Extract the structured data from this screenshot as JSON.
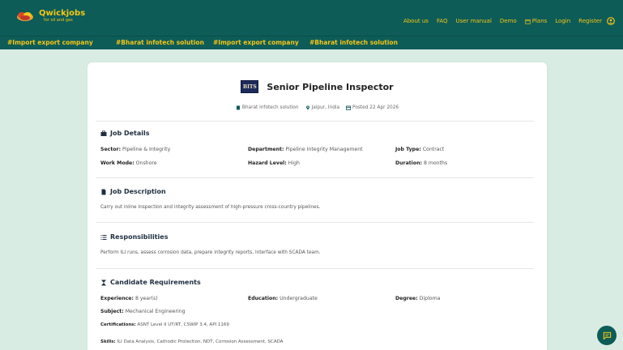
{
  "brand": {
    "name": "Qwickjobs",
    "tagline": "for oil and gas"
  },
  "nav": {
    "links": [
      "About us",
      "FAQ",
      "User manual",
      "Demo",
      "Plans",
      "Login",
      "Register"
    ]
  },
  "ticker": {
    "items": [
      "#Import export company",
      "#Bharat infotech solution",
      "#Import export company",
      "#Bharat infotech solution"
    ]
  },
  "job": {
    "logo_text": "BITS",
    "title": "Senior Pipeline Inspector",
    "company": "Bharat infotech solution",
    "location": "Jaipur, India",
    "posted": "Posted 22 Apr 2026"
  },
  "details": {
    "title": "Job Details",
    "sector_label": "Sector:",
    "sector": "Pipeline & Integrity",
    "department_label": "Department:",
    "department": "Pipeline Integrity Management",
    "job_type_label": "Job Type:",
    "job_type": "Contract",
    "work_mode_label": "Work Mode:",
    "work_mode": "Onshore",
    "hazard_label": "Hazard Level:",
    "hazard": "High",
    "duration_label": "Duration:",
    "duration": "8 months"
  },
  "description": {
    "title": "Job Description",
    "text": "Carry out inline inspection and integrity assessment of high-pressure cross-country pipelines."
  },
  "responsibilities": {
    "title": "Responsibilities",
    "text": "Perform ILI runs, assess corrosion data, prepare integrity reports, interface with SCADA team."
  },
  "requirements": {
    "title": "Candidate Requirements",
    "experience_label": "Experience:",
    "experience": "8 year(s)",
    "education_label": "Education:",
    "education": "Undergraduate",
    "degree_label": "Degree:",
    "degree": "Diploma",
    "subject_label": "Subject:",
    "subject": "Mechanical Engineering",
    "certifications_label": "Certifications:",
    "certifications": "ASNT Level II UT/RT, CSWIP 3.4, API 1169",
    "skills_label": "Skills:",
    "skills": "ILI Data Analysis, Cathodic Protection, NDT, Corrosion Assessment, SCADA"
  },
  "colors": {
    "primary": "#0d5c57",
    "accent": "#f5c518",
    "background": "#d9ece4"
  },
  "icons": [
    "logo-cloud-icon",
    "calendar-icon",
    "user-icon",
    "building-icon",
    "location-icon",
    "briefcase-icon",
    "document-icon",
    "list-icon",
    "hourglass-icon",
    "chat-icon"
  ]
}
